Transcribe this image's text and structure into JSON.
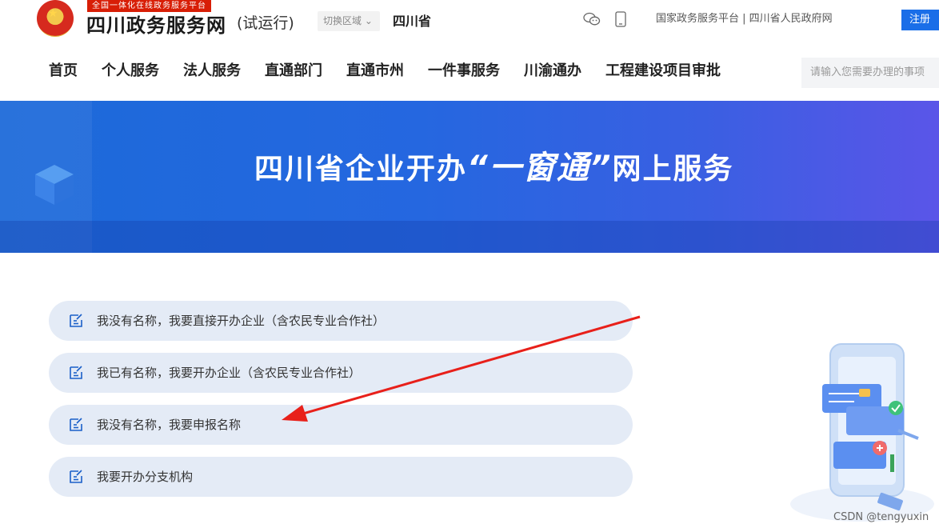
{
  "header": {
    "slogan": "全国一体化在线政务服务平台",
    "site_title": "四川政务服务网",
    "site_subtitle": "(试运行)",
    "region_switch_label": "切换区域 ⌄",
    "region_name": "四川省",
    "top_links": "国家政务服务平台 | 四川省人民政府网",
    "register_label": "注册"
  },
  "nav": {
    "items": [
      {
        "label": "首页"
      },
      {
        "label": "个人服务"
      },
      {
        "label": "法人服务"
      },
      {
        "label": "直通部门"
      },
      {
        "label": "直通市州"
      },
      {
        "label": "一件事服务"
      },
      {
        "label": "川渝通办"
      },
      {
        "label": "工程建设项目审批"
      }
    ],
    "search_placeholder": "请输入您需要办理的事项"
  },
  "banner": {
    "title_before": "四川省企业开办",
    "title_quoted": "“一窗通”",
    "title_after": "网上服务"
  },
  "options": [
    {
      "label": "我没有名称，我要直接开办企业（含农民专业合作社）"
    },
    {
      "label": "我已有名称，我要开办企业（含农民专业合作社）"
    },
    {
      "label": "我没有名称，我要申报名称"
    },
    {
      "label": "我要开办分支机构"
    }
  ],
  "annotation": {
    "color": "#e8201a"
  },
  "watermark": "CSDN @tengyuxin",
  "colors": {
    "brand_blue": "#1a6ee8",
    "slogan_red": "#d81e06",
    "option_bg": "#e4ebf6"
  }
}
